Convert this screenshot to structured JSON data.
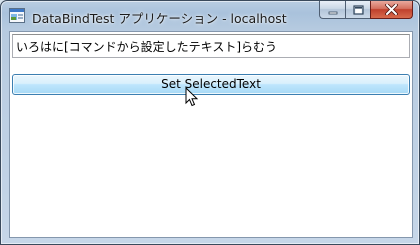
{
  "window": {
    "title": "DataBindTest アプリケーション - localhost",
    "icons": {
      "app": "app-window-icon",
      "minimize": "minimize-icon",
      "maximize": "maximize-icon",
      "close": "close-icon"
    }
  },
  "content": {
    "text_value": "いろはに[コマンドから設定したテキスト]らむう",
    "button_label": "Set SelectedText"
  },
  "cursor": {
    "icon": "mouse-pointer-icon"
  },
  "colors": {
    "button_border": "#3c7fb1",
    "close_button": "#c0402c"
  }
}
